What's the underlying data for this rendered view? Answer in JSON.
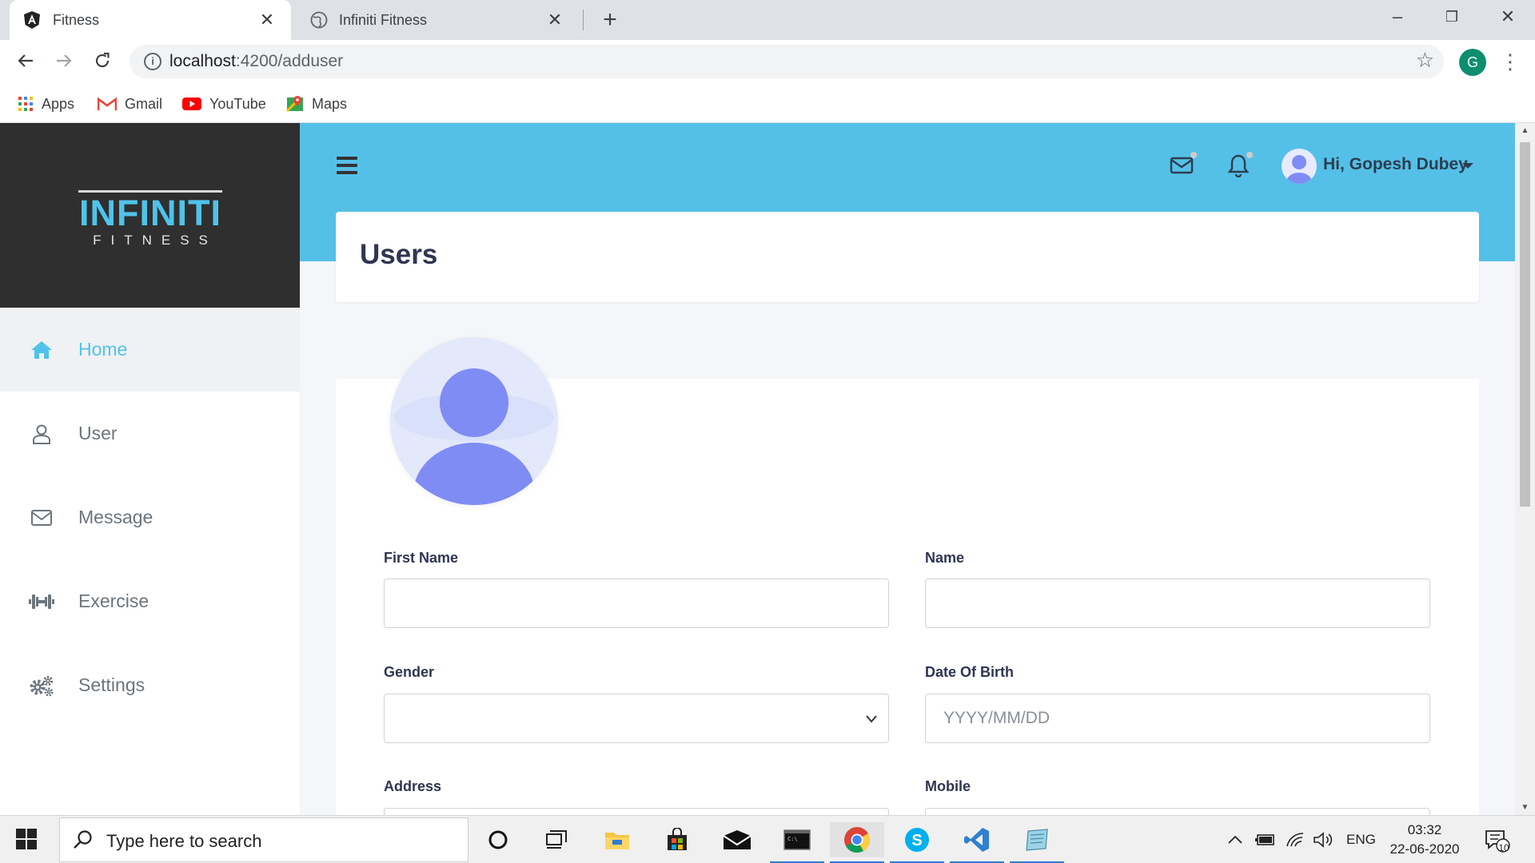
{
  "browser": {
    "tabs": [
      {
        "title": "Fitness",
        "active": true
      },
      {
        "title": "Infiniti Fitness",
        "active": false
      }
    ],
    "url_host": "localhost",
    "url_path": ":4200/adduser",
    "profile_initial": "G",
    "bookmarks": [
      "Apps",
      "Gmail",
      "YouTube",
      "Maps"
    ]
  },
  "brand": {
    "line1": "INFINITI",
    "line2": "FITNESS"
  },
  "sidebar": {
    "items": [
      {
        "label": "Home",
        "icon": "home-icon",
        "active": true
      },
      {
        "label": "User",
        "icon": "user-icon",
        "active": false
      },
      {
        "label": "Message",
        "icon": "envelope-icon",
        "active": false
      },
      {
        "label": "Exercise",
        "icon": "dumbbell-icon",
        "active": false
      },
      {
        "label": "Settings",
        "icon": "gears-icon",
        "active": false
      }
    ]
  },
  "header": {
    "greeting": "Hi, Gopesh Dubey"
  },
  "page": {
    "title": "Users"
  },
  "form": {
    "first_name": {
      "label": "First Name",
      "value": ""
    },
    "name": {
      "label": "Name",
      "value": ""
    },
    "gender": {
      "label": "Gender",
      "value": ""
    },
    "dob": {
      "label": "Date Of Birth",
      "placeholder": "YYYY/MM/DD"
    },
    "address": {
      "label": "Address"
    },
    "mobile": {
      "label": "Mobile"
    }
  },
  "taskbar": {
    "search_placeholder": "Type here to search",
    "language": "ENG",
    "time": "03:32",
    "date": "22-06-2020",
    "notification_count": "10"
  },
  "colors": {
    "accent": "#55c0e7",
    "brand_dark": "#2f2f2f",
    "active_menu": "#4fc3ea",
    "avatar": "#7f8cf3"
  }
}
